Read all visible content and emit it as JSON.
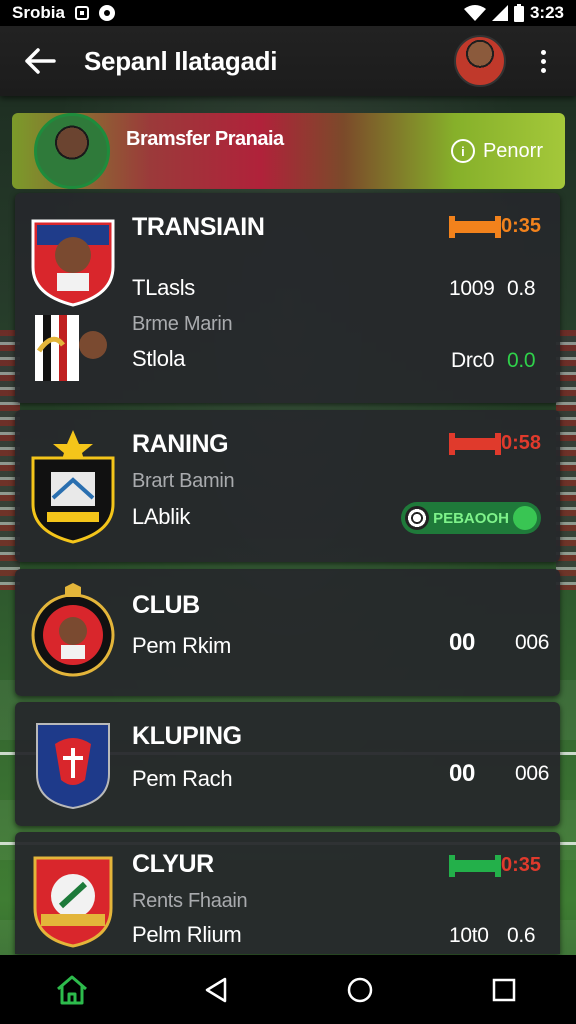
{
  "status_bar": {
    "carrier": "Srobia",
    "time": "3:23"
  },
  "app_bar": {
    "title": "Sepanl Ilatagadi"
  },
  "banner": {
    "title": "Bramsfer Pranaia",
    "action_label": "Penorr"
  },
  "cards": [
    {
      "name": "TRANSIAIN",
      "badge": "0:35",
      "badge_color": "#f2821c",
      "rows": [
        {
          "line": "TLasls",
          "val1": "1009",
          "val2": "0.8"
        },
        {
          "sub": "Brme Marin"
        },
        {
          "line": "Stlola",
          "val1": "Drc0",
          "val2": "0.0"
        }
      ]
    },
    {
      "name": "RANING",
      "badge": "0:58",
      "badge_color": "#e03a2c",
      "sub": "Brart Bamin",
      "line": "LAblik",
      "pill": "PEBAOOH"
    },
    {
      "name": "CLUB",
      "line": "Pem Rkim",
      "val1": "00",
      "val2": "006"
    },
    {
      "name": "KLUPING",
      "line": "Pem Rach",
      "val1": "00",
      "val2": "006"
    },
    {
      "name": "CLYUR",
      "badge": "0:35",
      "badge_color": "#23b04a",
      "sub": "Rents Fhaain",
      "line": "Pelm Rlium",
      "val1": "10t0",
      "val2": "0.6"
    }
  ]
}
